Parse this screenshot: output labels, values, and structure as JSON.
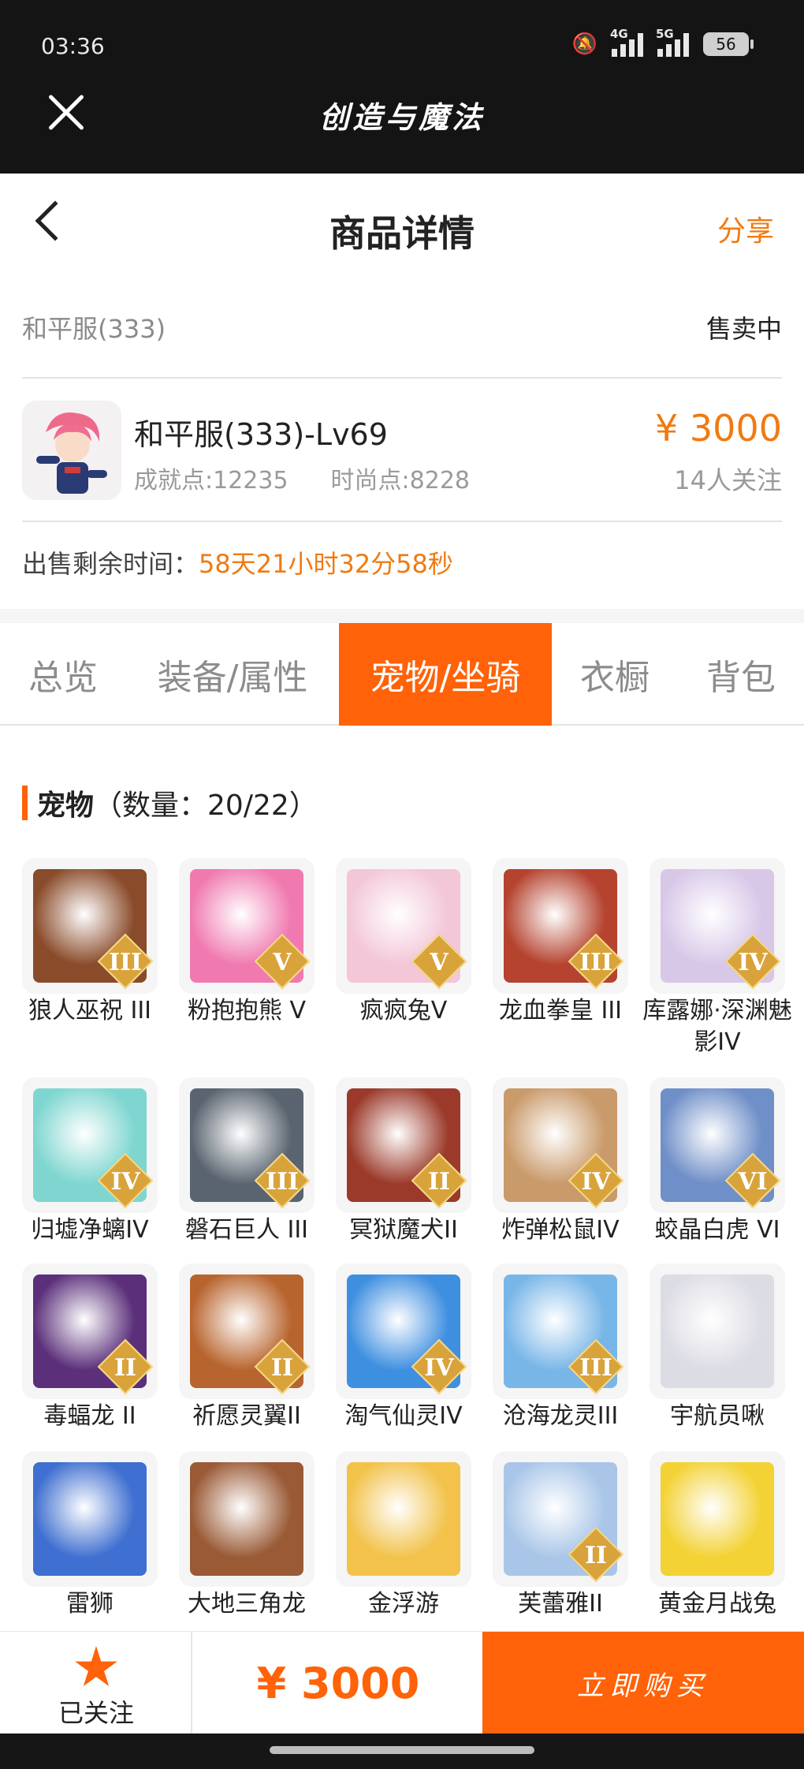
{
  "status_bar": {
    "time": "03:36",
    "net1": "4G",
    "net2": "5G",
    "battery": "56",
    "icons": [
      "bell-off-icon",
      "signal-icon",
      "signal-icon",
      "battery-icon"
    ]
  },
  "app": {
    "title": "创造与魔法",
    "close_icon": "close-icon"
  },
  "header": {
    "title": "商品详情",
    "share": "分享",
    "back_icon": "chevron-left-icon"
  },
  "server": {
    "name": "和平服(333)",
    "status": "售卖中"
  },
  "item": {
    "title": "和平服(333)-Lv69",
    "achievement": "成就点:12235",
    "fashion": "时尚点:8228",
    "price": "¥ 3000",
    "followers": "14人关注"
  },
  "remaining": {
    "label": "出售剩余时间：",
    "value": "58天21小时32分58秒"
  },
  "tabs": [
    {
      "label": "总览",
      "active": false
    },
    {
      "label": "装备/属性",
      "active": false
    },
    {
      "label": "宠物/坐骑",
      "active": true
    },
    {
      "label": "衣橱",
      "active": false
    },
    {
      "label": "背包",
      "active": false
    }
  ],
  "section": {
    "title": "宠物",
    "count": "（数量：20/22）"
  },
  "pets": [
    {
      "name": "狼人巫祝 III",
      "tier": "III",
      "color": "#8a4b2a"
    },
    {
      "name": "粉抱抱熊 V",
      "tier": "V",
      "color": "#f07ab0"
    },
    {
      "name": "疯疯兔V",
      "tier": "V",
      "color": "#f3c6d8"
    },
    {
      "name": "龙血拳皇 III",
      "tier": "III",
      "color": "#b5432f"
    },
    {
      "name": "库露娜·深渊魅影IV",
      "tier": "IV",
      "color": "#d8c8e8"
    },
    {
      "name": "归墟净螭IV",
      "tier": "IV",
      "color": "#7fd6d0"
    },
    {
      "name": "磐石巨人 III",
      "tier": "III",
      "color": "#5a6470"
    },
    {
      "name": "冥狱魔犬II",
      "tier": "II",
      "color": "#9b3a2a"
    },
    {
      "name": "炸弹松鼠IV",
      "tier": "IV",
      "color": "#c99a6a"
    },
    {
      "name": "蛟晶白虎 VI",
      "tier": "VI",
      "color": "#6f8fc8"
    },
    {
      "name": "毒蝠龙 II",
      "tier": "II",
      "color": "#5b2f7a"
    },
    {
      "name": "祈愿灵翼II",
      "tier": "II",
      "color": "#b8642e"
    },
    {
      "name": "淘气仙灵IV",
      "tier": "IV",
      "color": "#3f8fe0"
    },
    {
      "name": "沧海龙灵III",
      "tier": "III",
      "color": "#79b6e8"
    },
    {
      "name": "宇航员啾",
      "tier": "",
      "color": "#dcdce4"
    },
    {
      "name": "雷狮",
      "tier": "",
      "color": "#3f6fd0"
    },
    {
      "name": "大地三角龙",
      "tier": "",
      "color": "#9a5a36"
    },
    {
      "name": "金浮游",
      "tier": "",
      "color": "#f2c24a"
    },
    {
      "name": "芙蕾雅II",
      "tier": "II",
      "color": "#a9c6e8"
    },
    {
      "name": "黄金月战兔",
      "tier": "",
      "color": "#f3d235"
    }
  ],
  "bottom": {
    "follow_label": "已关注",
    "star_icon": "star-icon",
    "price": "¥ 3000",
    "buy_label": "立即购买"
  },
  "colors": {
    "accent": "#ff6208",
    "price": "#f07a12",
    "topbar": "#141414"
  }
}
